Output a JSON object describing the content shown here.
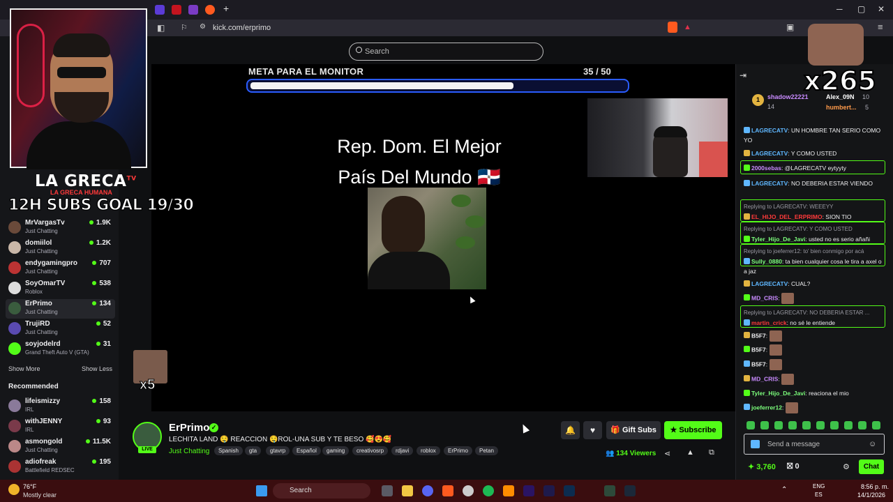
{
  "browser": {
    "url": "kick.com/erprimo",
    "search_placeholder": "Search"
  },
  "stream_overlay": {
    "goal_title": "META PARA EL MONITOR",
    "goal_count": "35  / 50",
    "goal_progress": 0.7,
    "text_line1": "Rep. Dom. El Mejor",
    "text_line2": "País Del Mundo 🇩🇴",
    "emote_count": "x5",
    "cam_title": "LA GRECA",
    "cam_title_suffix": "TV",
    "cam_subtitle": "LA GRECA HUMANA",
    "subs_goal": "12H SUBS GOAL 19/30"
  },
  "sidebar": {
    "channels": [
      {
        "name": "MrVargasTv",
        "category": "Just Chatting",
        "viewers": "1.9K",
        "color": "#6a4a3a"
      },
      {
        "name": "domiilol",
        "category": "Just Chatting",
        "viewers": "1.2K",
        "color": "#c9b7a8"
      },
      {
        "name": "endygamingpro",
        "category": "Just Chatting",
        "viewers": "707",
        "color": "#b33"
      },
      {
        "name": "SoyOmarTV",
        "category": "Roblox",
        "viewers": "538",
        "color": "#ddd"
      },
      {
        "name": "ErPrimo",
        "category": "Just Chatting",
        "viewers": "134",
        "color": "#3a5c3e"
      },
      {
        "name": "TrujiRD",
        "category": "Just Chatting",
        "viewers": "52",
        "color": "#5a4ab0"
      },
      {
        "name": "soyjodelrd",
        "category": "Grand Theft Auto V (GTA)",
        "viewers": "31",
        "color": "#53fc18"
      }
    ],
    "show_more": "Show More",
    "show_less": "Show Less",
    "recommended_title": "Recommended",
    "recommended": [
      {
        "name": "lifeismizzy",
        "category": "IRL",
        "viewers": "158",
        "color": "#8a7a9a"
      },
      {
        "name": "withJENNY",
        "category": "IRL",
        "viewers": "93",
        "color": "#7a3a4a"
      },
      {
        "name": "asmongold",
        "category": "Just Chatting",
        "viewers": "11.5K",
        "color": "#b88"
      },
      {
        "name": "adiofreak",
        "category": "Battlefield REDSEC",
        "viewers": "195",
        "color": "#a33"
      }
    ]
  },
  "stream": {
    "name": "ErPrimo",
    "live": "LIVE",
    "title": "LECHITA LAND 🤤 REACCION 🤤ROL-UNA SUB Y TE BESO 🥰😍🥰",
    "category": "Just Chatting",
    "tags": [
      "Spanish",
      "gta",
      "gtavrp",
      "Español",
      "gaming",
      "creativosrp",
      "rdjavi",
      "roblox",
      "ErPrimo",
      "Petan"
    ],
    "gift_subs": "Gift Subs",
    "subscribe": "Subscribe",
    "viewers": "134 Viewers"
  },
  "chat": {
    "leaderboard": {
      "first": {
        "rank": "1",
        "name": "shadow22221",
        "count": "14"
      },
      "second": {
        "name": "Alex_09N",
        "count": "10"
      },
      "third": {
        "name": "humbert...",
        "count": "5"
      }
    },
    "combo": "x265",
    "messages": [
      {
        "user": "LAGRECATV",
        "color": "#5fb7ff",
        "text": ": UN HOMBRE TAN SERIO COMO YO"
      },
      {
        "user": "LAGRECATV",
        "color": "#5fb7ff",
        "text": ": Y COMO USTED"
      },
      {
        "user": "2000sebas",
        "color": "#c98bff",
        "text": ": @LAGRECATV eytyyty"
      },
      {
        "user": "LAGRECATV",
        "color": "#5fb7ff",
        "text": ": NO DEBERIA ESTAR VIENDO"
      },
      {
        "reply": "Replying to LAGRECATV: WEEEYY",
        "user": "EL_HIJO_DEL_ERPRIMO",
        "color": "#ff3a3a",
        "text": ": SION TIO"
      },
      {
        "reply": "Replying to LAGRECATV: Y COMO USTED",
        "user": "Tyler_Hijo_De_Javi",
        "color": "#7cff7c",
        "text": ": usted no es serio añañi"
      },
      {
        "reply": "Replying to joeferrer12: to' bien conmigo por acá",
        "user": "Sully_0880",
        "color": "#7cff7c",
        "text": ": ta bien cualquier cosa le tira a axel o a jaz"
      },
      {
        "user": "LAGRECATV",
        "color": "#5fb7ff",
        "text": ": CUAL?"
      },
      {
        "user": "MD_CRIS",
        "color": "#c98bff",
        "text": ":"
      },
      {
        "reply": "Replying to LAGRECATV: NO DEBERIA ESTAR ...",
        "user": "martin_crick",
        "color": "#ff3a3a",
        "text": ": no sé le entiende"
      },
      {
        "user": "B5F7",
        "color": "#efeff1",
        "text": ":"
      },
      {
        "user": "B5F7",
        "color": "#efeff1",
        "text": ":"
      },
      {
        "user": "B5F7",
        "color": "#efeff1",
        "text": ":"
      },
      {
        "user": "MD_CRIS",
        "color": "#c98bff",
        "text": ":"
      },
      {
        "user": "Tyler_Hijo_De_Javi",
        "color": "#7cff7c",
        "text": ": reaciona el mio"
      },
      {
        "user": "joeferrer12",
        "color": "#7cff7c",
        "text": ":"
      }
    ],
    "send_placeholder": "Send a message",
    "points": "3,760",
    "gifts": "0",
    "chat_button": "Chat"
  },
  "taskbar": {
    "temperature": "76°F",
    "weather": "Mostly clear",
    "search": "Search",
    "lang": "ENG",
    "region": "ES",
    "time": "8:56 p. m.",
    "date": "14/1/2026"
  }
}
